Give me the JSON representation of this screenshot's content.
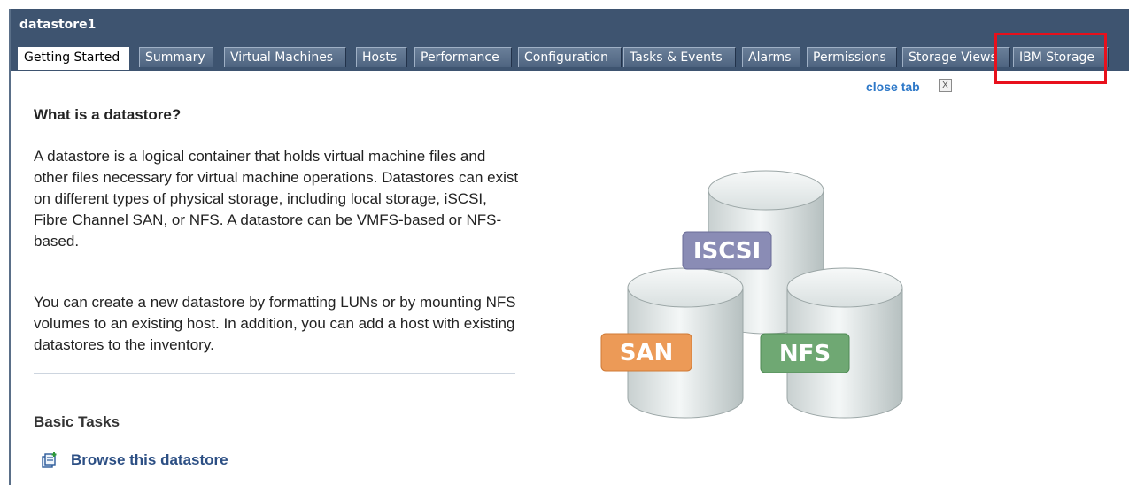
{
  "window": {
    "title": "datastore1"
  },
  "tabs": [
    {
      "label": "Getting Started",
      "active": true
    },
    {
      "label": "Summary"
    },
    {
      "label": "Virtual Machines"
    },
    {
      "label": "Hosts"
    },
    {
      "label": "Performance"
    },
    {
      "label": "Configuration"
    },
    {
      "label": "Tasks & Events"
    },
    {
      "label": "Alarms"
    },
    {
      "label": "Permissions"
    },
    {
      "label": "Storage Views"
    },
    {
      "label": "IBM Storage"
    }
  ],
  "close_tab": {
    "label": "close tab",
    "icon_text": "X"
  },
  "intro": {
    "heading": "What is a datastore?",
    "paragraph1": "A datastore is a logical container that holds virtual machine files and other files necessary for virtual machine operations. Datastores can exist on different types of physical storage, including local storage, iSCSI, Fibre Channel SAN, or NFS. A datastore can be VMFS-based or NFS-based.",
    "paragraph2": "You can create a new datastore by formatting LUNs or by mounting NFS volumes to an existing host. In addition, you can add a host with existing datastores to the inventory."
  },
  "basic_tasks": {
    "heading": "Basic Tasks",
    "items": [
      {
        "label": "Browse this datastore",
        "icon": "browse-datastore-icon"
      }
    ]
  },
  "illustration": {
    "labels": {
      "iscsi": "ISCSI",
      "san": "SAN",
      "nfs": "NFS"
    },
    "colors": {
      "iscsi": "#8a8cb5",
      "san": "#ec9a57",
      "nfs": "#6fa873"
    }
  },
  "annotation": {
    "highlight_color": "#e8101c"
  }
}
